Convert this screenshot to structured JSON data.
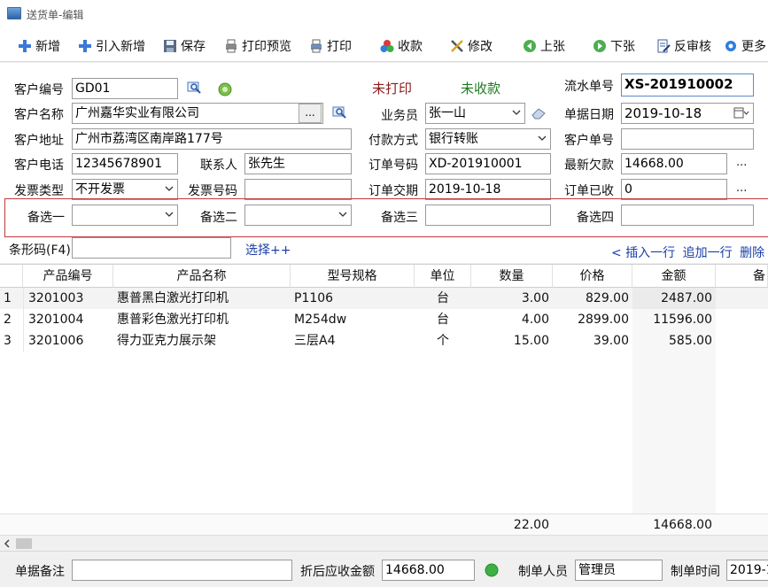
{
  "window": {
    "title": "送货单-编辑"
  },
  "toolbar": {
    "new_label": "新增",
    "import_new_label": "引入新增",
    "save_label": "保存",
    "print_preview_label": "打印预览",
    "print_label": "打印",
    "collect_label": "收款",
    "modify_label": "修改",
    "prev_label": "上张",
    "next_label": "下张",
    "unapprove_label": "反审核",
    "more_label": "更多"
  },
  "form": {
    "customer_code": {
      "label": "客户编号",
      "value": "GD01"
    },
    "customer_name": {
      "label": "客户名称",
      "value": "广州嘉华实业有限公司"
    },
    "customer_address": {
      "label": "客户地址",
      "value": "广州市荔湾区南岸路177号"
    },
    "customer_phone": {
      "label": "客户电话",
      "value": "12345678901"
    },
    "contact": {
      "label": "联系人",
      "value": "张先生"
    },
    "invoice_type": {
      "label": "发票类型",
      "value": "不开发票"
    },
    "invoice_no": {
      "label": "发票号码",
      "value": ""
    },
    "status_print": "未打印",
    "status_payment": "未收款",
    "salesperson": {
      "label": "业务员",
      "value": "张一山"
    },
    "payment_method": {
      "label": "付款方式",
      "value": "银行转账"
    },
    "order_no": {
      "label": "订单号码",
      "value": "XD-201910001"
    },
    "order_date": {
      "label": "订单交期",
      "value": "2019-10-18"
    },
    "serial_no": {
      "label": "流水单号",
      "value": "XS-201910002"
    },
    "doc_date": {
      "label": "单据日期",
      "value": "2019-10-18"
    },
    "customer_doc_no": {
      "label": "客户单号",
      "value": ""
    },
    "latest_debt": {
      "label": "最新欠款",
      "value": "14668.00"
    },
    "order_received": {
      "label": "订单已收",
      "value": "0"
    },
    "option1": {
      "label": "备选一",
      "value": ""
    },
    "option2": {
      "label": "备选二",
      "value": ""
    },
    "option3": {
      "label": "备选三",
      "value": ""
    },
    "option4": {
      "label": "备选四",
      "value": ""
    },
    "ellipsis": "...",
    "more_dots": "..."
  },
  "barcode": {
    "label": "条形码(F4)",
    "value": "",
    "select_link": "选择++"
  },
  "row_actions": {
    "insert_prefix": "<",
    "insert": "插入一行",
    "append": "追加一行",
    "delete": "删除"
  },
  "grid": {
    "columns": [
      "产品编号",
      "产品名称",
      "型号规格",
      "单位",
      "数量",
      "价格",
      "金额",
      "备"
    ],
    "rows": [
      {
        "idx": "1",
        "code": "3201003",
        "name": "惠普黑白激光打印机",
        "spec": "P1106",
        "unit": "台",
        "qty": "3.00",
        "price": "829.00",
        "amount": "2487.00"
      },
      {
        "idx": "2",
        "code": "3201004",
        "name": "惠普彩色激光打印机",
        "spec": "M254dw",
        "unit": "台",
        "qty": "4.00",
        "price": "2899.00",
        "amount": "11596.00"
      },
      {
        "idx": "3",
        "code": "3201006",
        "name": "得力亚克力展示架",
        "spec": "三层A4",
        "unit": "个",
        "qty": "15.00",
        "price": "39.00",
        "amount": "585.00"
      }
    ],
    "totals": {
      "qty": "22.00",
      "amount": "14668.00"
    }
  },
  "footer": {
    "remark": {
      "label": "单据备注",
      "value": ""
    },
    "discounted_amount": {
      "label": "折后应收金额",
      "value": "14668.00"
    },
    "creator": {
      "label": "制单人员",
      "value": "管理员"
    },
    "created_time": {
      "label": "制单时间",
      "value": "2019-1"
    }
  },
  "colors": {
    "status_print": "#8b1a1a",
    "status_payment": "#1f7a1f",
    "frame": "#c0393b",
    "link": "#1a3fa8",
    "green_dot": "#3cb043"
  }
}
